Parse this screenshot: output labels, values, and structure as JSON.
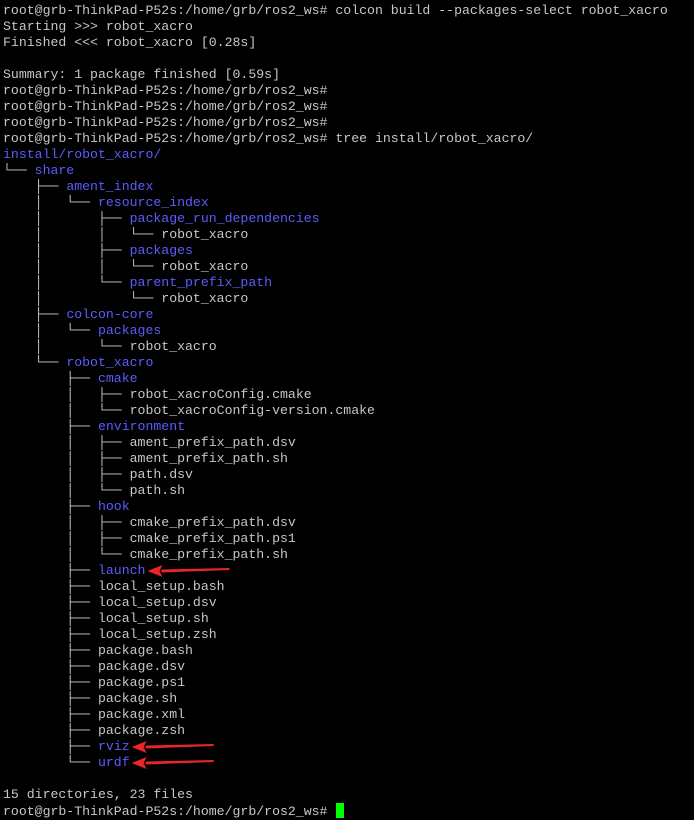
{
  "terminal": {
    "prompt": "root@grb-ThinkPad-P52s:/home/grb/ros2_ws#",
    "colors": {
      "background": "#000000",
      "text": "#c7c7c7",
      "directory": "#5a5cff",
      "cursor": "#00ff00",
      "annotation_arrow": "#e8262a"
    },
    "lines": [
      {
        "type": "cmd",
        "text": "root@grb-ThinkPad-P52s:/home/grb/ros2_ws# colcon build --packages-select robot_xacro"
      },
      {
        "type": "text",
        "text": "Starting >>> robot_xacro"
      },
      {
        "type": "text",
        "text": "Finished <<< robot_xacro [0.28s]"
      },
      {
        "type": "blank",
        "text": ""
      },
      {
        "type": "text",
        "text": "Summary: 1 package finished [0.59s]"
      },
      {
        "type": "cmd",
        "text": "root@grb-ThinkPad-P52s:/home/grb/ros2_ws#"
      },
      {
        "type": "cmd",
        "text": "root@grb-ThinkPad-P52s:/home/grb/ros2_ws#"
      },
      {
        "type": "cmd",
        "text": "root@grb-ThinkPad-P52s:/home/grb/ros2_ws#"
      },
      {
        "type": "cmd",
        "text": "root@grb-ThinkPad-P52s:/home/grb/ros2_ws# tree install/robot_xacro/"
      },
      {
        "type": "tree",
        "prefix": "",
        "name": "install/robot_xacro/",
        "kind": "dir"
      },
      {
        "type": "tree",
        "prefix": "└── ",
        "name": "share",
        "kind": "dir"
      },
      {
        "type": "tree",
        "prefix": "    ├── ",
        "name": "ament_index",
        "kind": "dir"
      },
      {
        "type": "tree",
        "prefix": "    │   └── ",
        "name": "resource_index",
        "kind": "dir"
      },
      {
        "type": "tree",
        "prefix": "    │       ├── ",
        "name": "package_run_dependencies",
        "kind": "dir"
      },
      {
        "type": "tree",
        "prefix": "    │       │   └── ",
        "name": "robot_xacro",
        "kind": "file"
      },
      {
        "type": "tree",
        "prefix": "    │       ├── ",
        "name": "packages",
        "kind": "dir"
      },
      {
        "type": "tree",
        "prefix": "    │       │   └── ",
        "name": "robot_xacro",
        "kind": "file"
      },
      {
        "type": "tree",
        "prefix": "    │       └── ",
        "name": "parent_prefix_path",
        "kind": "dir"
      },
      {
        "type": "tree",
        "prefix": "    │           └── ",
        "name": "robot_xacro",
        "kind": "file"
      },
      {
        "type": "tree",
        "prefix": "    ├── ",
        "name": "colcon-core",
        "kind": "dir"
      },
      {
        "type": "tree",
        "prefix": "    │   └── ",
        "name": "packages",
        "kind": "dir"
      },
      {
        "type": "tree",
        "prefix": "    │       └── ",
        "name": "robot_xacro",
        "kind": "file"
      },
      {
        "type": "tree",
        "prefix": "    └── ",
        "name": "robot_xacro",
        "kind": "dir"
      },
      {
        "type": "tree",
        "prefix": "        ├── ",
        "name": "cmake",
        "kind": "dir"
      },
      {
        "type": "tree",
        "prefix": "        │   ├── ",
        "name": "robot_xacroConfig.cmake",
        "kind": "file"
      },
      {
        "type": "tree",
        "prefix": "        │   └── ",
        "name": "robot_xacroConfig-version.cmake",
        "kind": "file"
      },
      {
        "type": "tree",
        "prefix": "        ├── ",
        "name": "environment",
        "kind": "dir"
      },
      {
        "type": "tree",
        "prefix": "        │   ├── ",
        "name": "ament_prefix_path.dsv",
        "kind": "file"
      },
      {
        "type": "tree",
        "prefix": "        │   ├── ",
        "name": "ament_prefix_path.sh",
        "kind": "file"
      },
      {
        "type": "tree",
        "prefix": "        │   ├── ",
        "name": "path.dsv",
        "kind": "file"
      },
      {
        "type": "tree",
        "prefix": "        │   └── ",
        "name": "path.sh",
        "kind": "file"
      },
      {
        "type": "tree",
        "prefix": "        ├── ",
        "name": "hook",
        "kind": "dir"
      },
      {
        "type": "tree",
        "prefix": "        │   ├── ",
        "name": "cmake_prefix_path.dsv",
        "kind": "file"
      },
      {
        "type": "tree",
        "prefix": "        │   ├── ",
        "name": "cmake_prefix_path.ps1",
        "kind": "file"
      },
      {
        "type": "tree",
        "prefix": "        │   └── ",
        "name": "cmake_prefix_path.sh",
        "kind": "file"
      },
      {
        "type": "tree",
        "prefix": "        ├── ",
        "name": "launch",
        "kind": "dir",
        "arrow": true
      },
      {
        "type": "tree",
        "prefix": "        ├── ",
        "name": "local_setup.bash",
        "kind": "file"
      },
      {
        "type": "tree",
        "prefix": "        ├── ",
        "name": "local_setup.dsv",
        "kind": "file"
      },
      {
        "type": "tree",
        "prefix": "        ├── ",
        "name": "local_setup.sh",
        "kind": "file"
      },
      {
        "type": "tree",
        "prefix": "        ├── ",
        "name": "local_setup.zsh",
        "kind": "file"
      },
      {
        "type": "tree",
        "prefix": "        ├── ",
        "name": "package.bash",
        "kind": "file"
      },
      {
        "type": "tree",
        "prefix": "        ├── ",
        "name": "package.dsv",
        "kind": "file"
      },
      {
        "type": "tree",
        "prefix": "        ├── ",
        "name": "package.ps1",
        "kind": "file"
      },
      {
        "type": "tree",
        "prefix": "        ├── ",
        "name": "package.sh",
        "kind": "file"
      },
      {
        "type": "tree",
        "prefix": "        ├── ",
        "name": "package.xml",
        "kind": "file"
      },
      {
        "type": "tree",
        "prefix": "        ├── ",
        "name": "package.zsh",
        "kind": "file"
      },
      {
        "type": "tree",
        "prefix": "        ├── ",
        "name": "rviz",
        "kind": "dir",
        "arrow": true
      },
      {
        "type": "tree",
        "prefix": "        └── ",
        "name": "urdf",
        "kind": "dir",
        "arrow": true
      },
      {
        "type": "blank",
        "text": ""
      },
      {
        "type": "text",
        "text": "15 directories, 23 files"
      },
      {
        "type": "cmd",
        "text": "root@grb-ThinkPad-P52s:/home/grb/ros2_ws# ",
        "cursor": true
      }
    ]
  }
}
